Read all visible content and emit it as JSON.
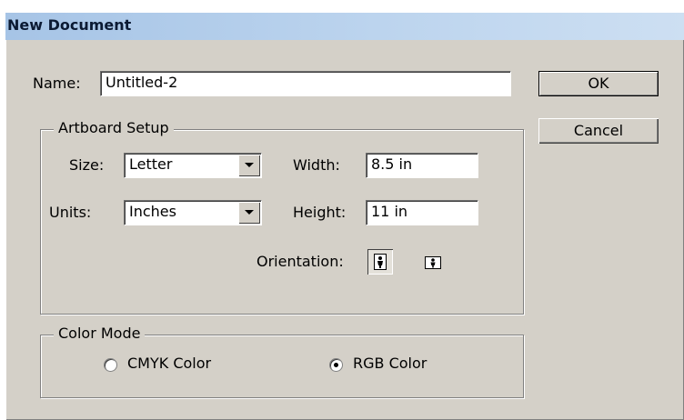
{
  "dialog": {
    "title": "New Document"
  },
  "name_field": {
    "label": "Name:",
    "value": "Untitled-2"
  },
  "buttons": {
    "ok": "OK",
    "cancel": "Cancel"
  },
  "artboard": {
    "title": "Artboard Setup",
    "size_label": "Size:",
    "size_value": "Letter",
    "units_label": "Units:",
    "units_value": "Inches",
    "width_label": "Width:",
    "width_value": "8.5 in",
    "height_label": "Height:",
    "height_value": "11 in",
    "orientation_label": "Orientation:",
    "orientation_selected": "portrait"
  },
  "color_mode": {
    "title": "Color Mode",
    "cmyk_label": "CMYK Color",
    "rgb_label": "RGB Color",
    "selected": "rgb"
  },
  "icons": {
    "dropdown": "chevron-down-icon",
    "portrait": "portrait-orientation-icon",
    "landscape": "landscape-orientation-icon"
  },
  "colors": {
    "dialog_bg": "#d4d0c8",
    "titlebar_start": "#a6c4e6",
    "titlebar_end": "#cddff2"
  }
}
